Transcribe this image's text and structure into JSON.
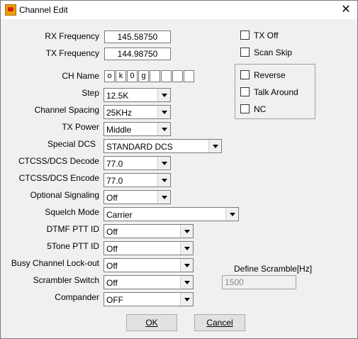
{
  "window": {
    "title": "Channel Edit"
  },
  "fields": {
    "rx_frequency": {
      "label": "RX Frequency",
      "value": "145.58750"
    },
    "tx_frequency": {
      "label": "TX Frequency",
      "value": "144.98750"
    },
    "ch_name": {
      "label": "CH Name",
      "chars": [
        "o",
        "k",
        "0",
        "g",
        "",
        "",
        "",
        ""
      ]
    },
    "step": {
      "label": "Step",
      "value": "12.5K"
    },
    "channel_spacing": {
      "label": "Channel Spacing",
      "value": "25KHz"
    },
    "tx_power": {
      "label": "TX Power",
      "value": "Middle"
    },
    "special_dcs": {
      "label": "Special DCS",
      "value": "STANDARD DCS"
    },
    "ctcss_decode": {
      "label": "CTCSS/DCS Decode",
      "value": "77.0"
    },
    "ctcss_encode": {
      "label": "CTCSS/DCS Encode",
      "value": "77.0"
    },
    "optional_signaling": {
      "label": "Optional Signaling",
      "value": "Off"
    },
    "squelch_mode": {
      "label": "Squelch Mode",
      "value": "Carrier"
    },
    "dtmf_ptt_id": {
      "label": "DTMF PTT ID",
      "value": "Off"
    },
    "fivetone_ptt_id": {
      "label": "5Tone PTT ID",
      "value": "Off"
    },
    "busy_lockout": {
      "label": "Busy Channel Lock-out",
      "value": "Off"
    },
    "scrambler_switch": {
      "label": "Scrambler Switch",
      "value": "Off"
    },
    "compander": {
      "label": "Compander",
      "value": "OFF"
    },
    "define_scramble": {
      "label": "Define Scramble[Hz]",
      "value": "1500"
    }
  },
  "checkboxes": {
    "tx_off": {
      "label": "TX Off",
      "checked": false
    },
    "scan_skip": {
      "label": "Scan Skip",
      "checked": false
    },
    "reverse": {
      "label": "Reverse",
      "checked": false
    },
    "talk_around": {
      "label": "Talk Around",
      "checked": false
    },
    "nc": {
      "label": "NC",
      "checked": false
    }
  },
  "buttons": {
    "ok": "OK",
    "cancel": "Cancel"
  }
}
